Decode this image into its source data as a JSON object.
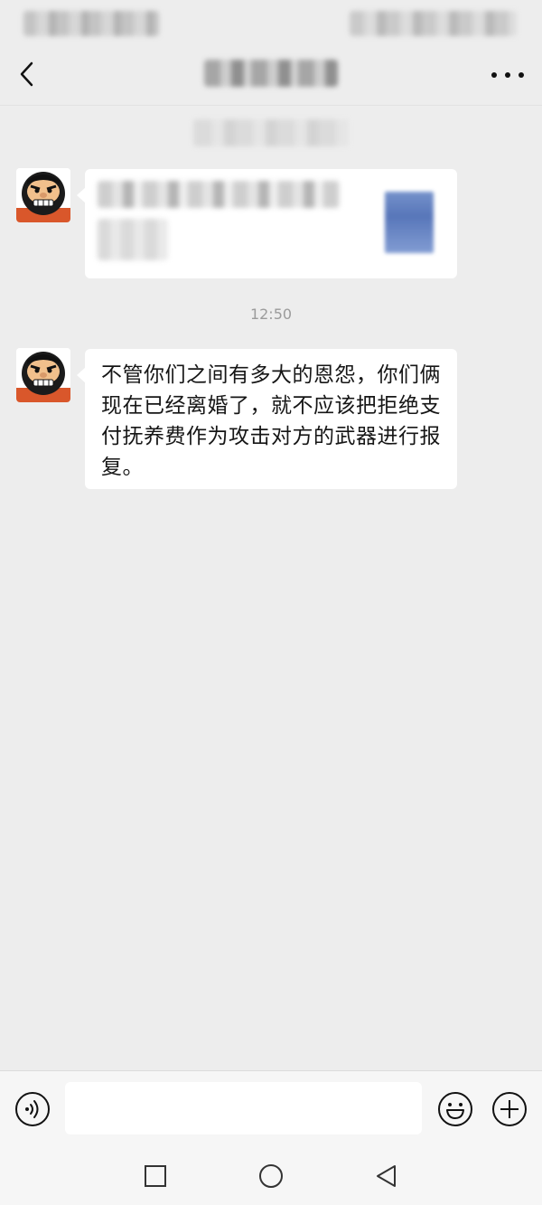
{
  "chat": {
    "timestamp": "12:50",
    "messages": [
      {
        "type": "shared-card"
      },
      {
        "type": "text",
        "text": "不管你们之间有多大的恩怨，你们俩现在已经离婚了，就不应该把拒绝支付抚养费作为攻击对方的武器进行报复。"
      }
    ]
  },
  "input": {
    "value": "",
    "placeholder": ""
  },
  "icons": {
    "back": "back-chevron-icon",
    "more": "more-dots-icon",
    "voice": "voice-icon",
    "emoji": "emoji-icon",
    "plus": "plus-icon",
    "nav_recent": "square-icon",
    "nav_home": "circle-icon",
    "nav_back": "triangle-icon"
  },
  "colors": {
    "background": "#ededed",
    "bubble": "#ffffff",
    "text": "#161616",
    "timestamp": "#9b9b9b"
  }
}
